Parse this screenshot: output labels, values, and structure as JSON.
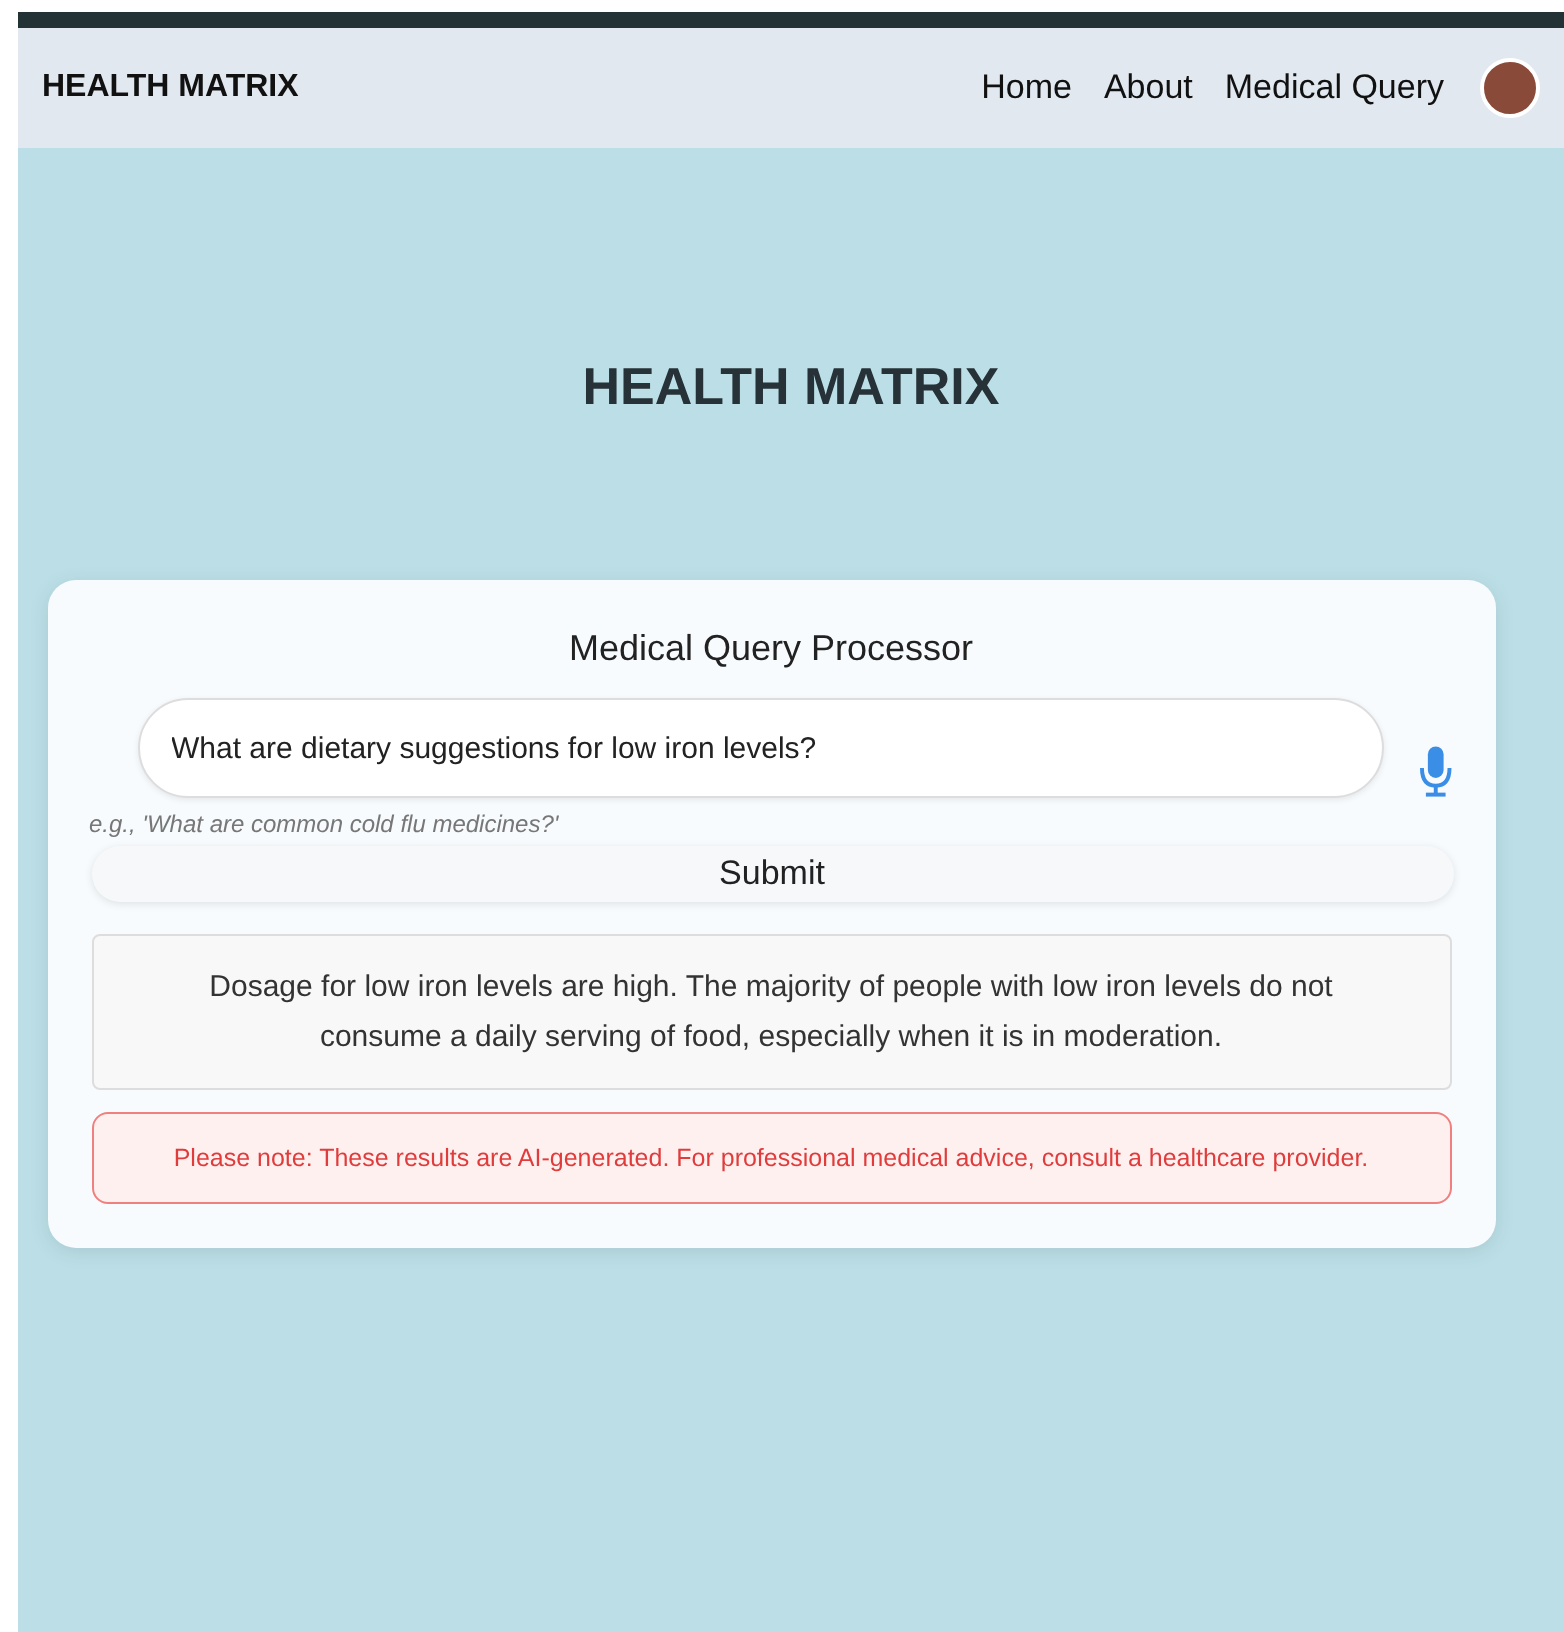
{
  "navbar": {
    "brand": "HEALTH MATRIX",
    "links": [
      "Home",
      "About",
      "Medical Query"
    ]
  },
  "hero": {
    "title": "HEALTH MATRIX"
  },
  "query_card": {
    "title": "Medical Query Processor",
    "query": {
      "value": "What are dietary suggestions for low iron levels?"
    },
    "hint": "e.g., 'What are common cold flu medicines?'",
    "submit": "Submit",
    "response": "Dosage for low iron levels are high. The majority of people with low iron levels do not consume a daily serving of food, especially when it is in moderation.",
    "notice": "Please note: These results are AI-generated. For professional medical advice, consult a healthcare provider."
  }
}
